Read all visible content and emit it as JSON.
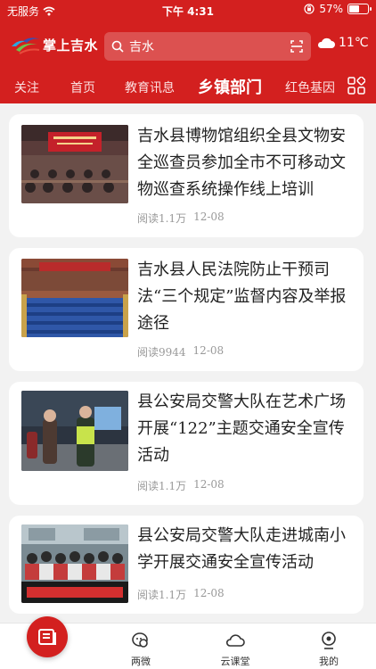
{
  "status_bar": {
    "carrier": "无服务",
    "time": "下午 4:31",
    "battery": "57%",
    "battery_level": 0.57
  },
  "header": {
    "app_name": "掌上吉水",
    "search_text": "吉水",
    "temperature": "11℃"
  },
  "tabs": [
    {
      "label": "关注"
    },
    {
      "label": "首页"
    },
    {
      "label": "教育讯息"
    },
    {
      "label": "乡镇部门",
      "active": true
    },
    {
      "label": "红色基因"
    }
  ],
  "articles": [
    {
      "title": "吉水县博物馆组织全县文物安全巡查员参加全市不可移动文物巡查系统操作线上培训",
      "reads": "阅读1.1万",
      "date": "12-08"
    },
    {
      "title": "吉水县人民法院防止干预司法“三个规定”监督内容及举报途径",
      "reads": "阅读9944",
      "date": "12-08"
    },
    {
      "title": "县公安局交警大队在艺术广场开展“122”主题交通安全宣传活动",
      "reads": "阅读1.1万",
      "date": "12-08"
    },
    {
      "title": "县公安局交警大队走进城南小学开展交通安全宣传活动",
      "reads": "阅读1.1万",
      "date": "12-08"
    }
  ],
  "bottom_nav": [
    {
      "label": ""
    },
    {
      "label": "两微"
    },
    {
      "label": "云课堂"
    },
    {
      "label": "我的"
    }
  ],
  "colors": {
    "brand": "#d3201f",
    "background": "#f2f2f2",
    "meta": "#999999"
  }
}
